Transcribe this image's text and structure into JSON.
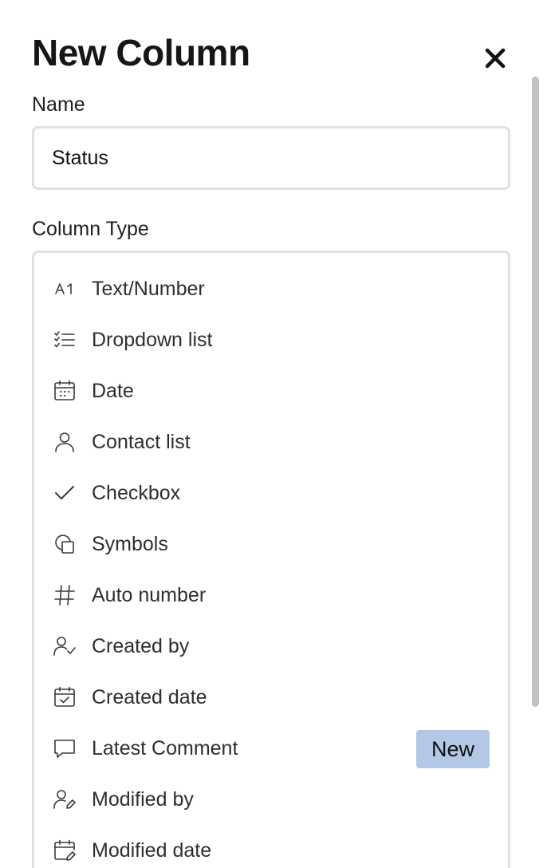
{
  "dialog": {
    "title": "New Column",
    "close_icon": "close-icon"
  },
  "name_field": {
    "label": "Name",
    "value": "Status"
  },
  "column_type": {
    "label": "Column Type",
    "options": [
      {
        "label": "Text/Number",
        "icon": "text-number-icon"
      },
      {
        "label": "Dropdown list",
        "icon": "dropdown-list-icon"
      },
      {
        "label": "Date",
        "icon": "calendar-icon"
      },
      {
        "label": "Contact list",
        "icon": "person-icon"
      },
      {
        "label": "Checkbox",
        "icon": "checkmark-icon"
      },
      {
        "label": "Symbols",
        "icon": "symbols-icon"
      },
      {
        "label": "Auto number",
        "icon": "hash-icon"
      },
      {
        "label": "Created by",
        "icon": "person-check-icon"
      },
      {
        "label": "Created date",
        "icon": "calendar-check-icon"
      },
      {
        "label": "Latest Comment",
        "icon": "comment-icon",
        "badge": "New"
      },
      {
        "label": "Modified by",
        "icon": "person-edit-icon"
      },
      {
        "label": "Modified date",
        "icon": "calendar-edit-icon"
      }
    ]
  },
  "colors": {
    "badge_background": "#b3c7e6",
    "border": "#e1e1e1",
    "scrollbar": "#c2c2c2"
  }
}
